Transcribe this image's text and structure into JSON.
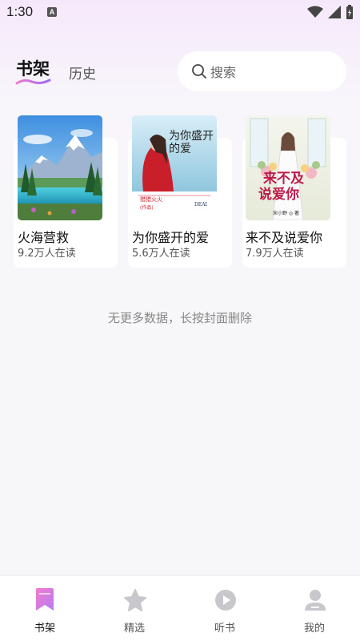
{
  "status": {
    "time": "1:30",
    "badge": "A"
  },
  "header": {
    "tabs": [
      {
        "label": "书架",
        "active": true
      },
      {
        "label": "历史",
        "active": false
      }
    ],
    "search": {
      "placeholder": "搜索"
    }
  },
  "books": [
    {
      "title": "火海营救",
      "reads": "9.2万人在读",
      "cover": "mountain-lake-cover"
    },
    {
      "title": "为你盛开的爱",
      "reads": "5.6万人在读",
      "cover": "red-girl-cover",
      "cover_title": "为你盛开的爱",
      "cover_author": "猎猎火火",
      "cover_small": "(作品)",
      "cover_text": "DEAI"
    },
    {
      "title": "来不及说爱你",
      "reads": "7.9万人在读",
      "cover": "bride-flowers-cover",
      "cover_title_1": "来不及",
      "cover_title_2": "说爱你",
      "cover_author": "宋小野 ◎ 著"
    }
  ],
  "empty_hint": "无更多数据，长按封面删除",
  "nav": [
    {
      "label": "书架",
      "icon": "bookmark-icon",
      "active": true
    },
    {
      "label": "精选",
      "icon": "star-icon",
      "active": false
    },
    {
      "label": "听书",
      "icon": "play-icon",
      "active": false
    },
    {
      "label": "我的",
      "icon": "user-icon",
      "active": false
    }
  ],
  "colors": {
    "accent": "#e07ad6",
    "nav_inactive": "#c8c8cc"
  }
}
